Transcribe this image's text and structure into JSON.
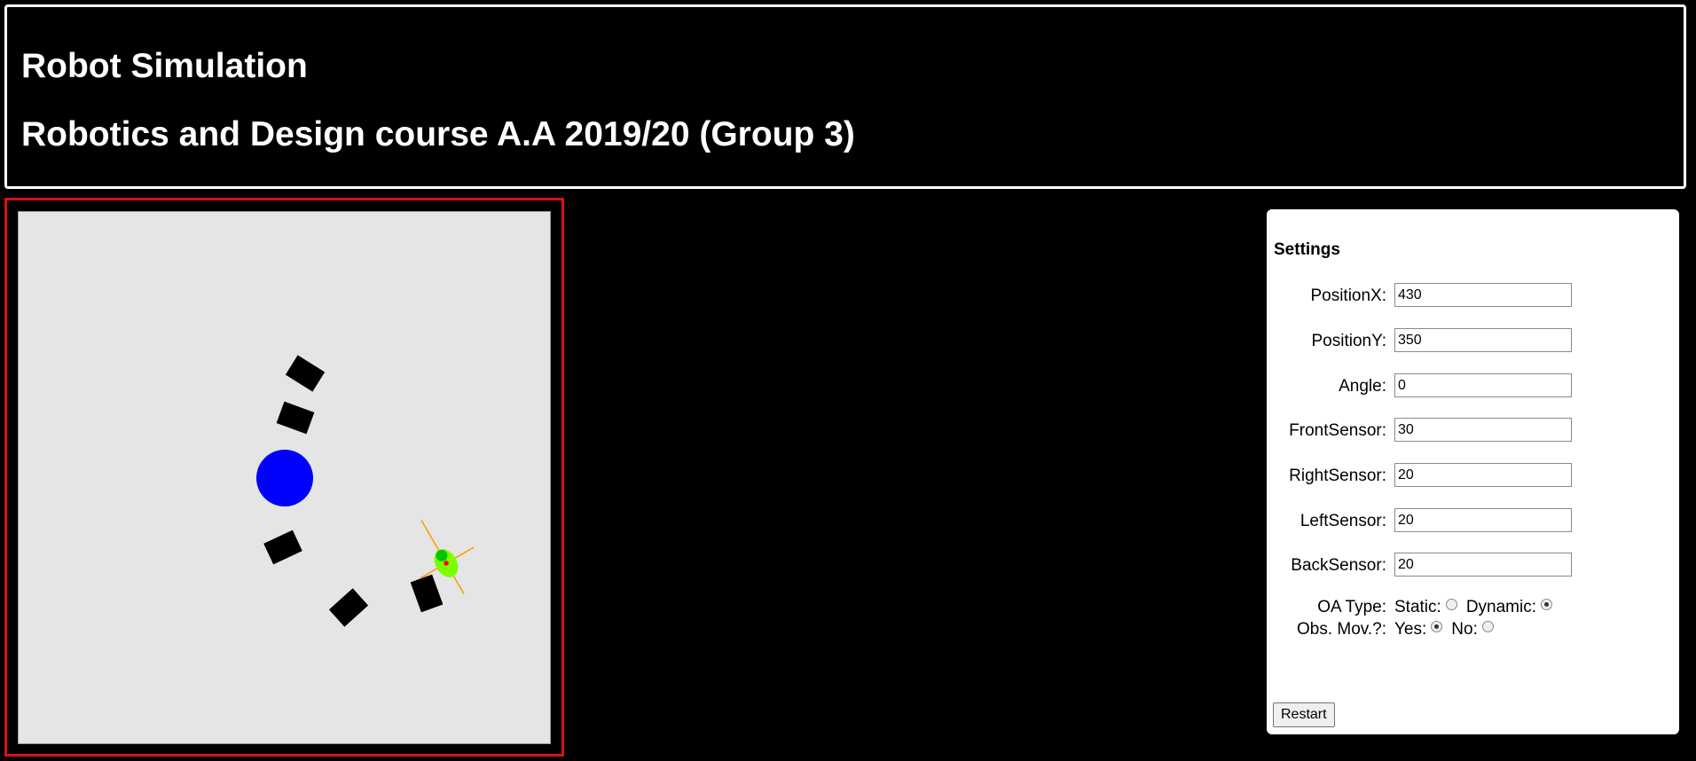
{
  "header": {
    "title": "Robot Simulation",
    "subtitle": "Robotics and Design course A.A 2019/20 (Group 3)"
  },
  "colors": {
    "arena_background": "#e5e5e5",
    "frame_border": "#d41414",
    "goal": "#0000ff",
    "obstacle": "#000000",
    "robot_body": "#7cff00",
    "robot_head": "#00c400",
    "robot_center": "#ff0000",
    "sensor_ray": "#ff9900"
  },
  "settings": {
    "title": "Settings",
    "fields": [
      {
        "label": "PositionX:",
        "value": "430"
      },
      {
        "label": "PositionY:",
        "value": "350"
      },
      {
        "label": "Angle:",
        "value": "0"
      },
      {
        "label": "FrontSensor:",
        "value": "30"
      },
      {
        "label": "RightSensor:",
        "value": "20"
      },
      {
        "label": "LeftSensor:",
        "value": "20"
      },
      {
        "label": "BackSensor:",
        "value": "20"
      }
    ],
    "oa_type": {
      "label": "OA Type:",
      "options": [
        {
          "label": "Static:",
          "checked": false
        },
        {
          "label": "Dynamic:",
          "checked": true
        }
      ]
    },
    "obs_mov": {
      "label": "Obs. Mov.?:",
      "options": [
        {
          "label": "Yes:",
          "checked": true
        },
        {
          "label": "No:",
          "checked": false
        }
      ]
    },
    "restart_label": "Restart"
  }
}
